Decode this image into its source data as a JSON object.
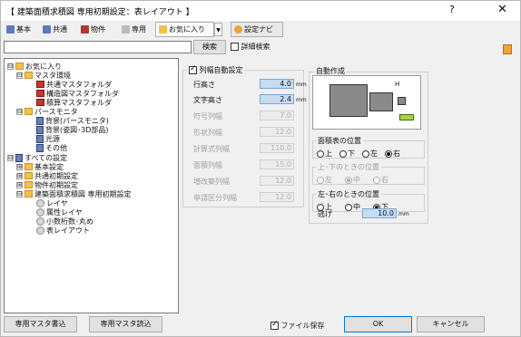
{
  "window": {
    "title": "【 建築面積求積図 専用初期設定：表レイアウト 】",
    "help_label": "?",
    "close_label": "✕"
  },
  "tabs": [
    {
      "label": "基本",
      "icon": "basic-icon",
      "color": "#5a7bbf"
    },
    {
      "label": "共通",
      "icon": "common-icon",
      "color": "#5a7bbf"
    },
    {
      "label": "物件",
      "icon": "property-icon",
      "color": "#b03a2e"
    },
    {
      "label": "専用",
      "icon": "dedicated-icon",
      "color": "#888888"
    },
    {
      "label": "お気に入り",
      "icon": "favorite-icon",
      "color": "#f5c14b"
    },
    {
      "label": "設定ナビ",
      "icon": "navi-icon",
      "color": "#e8a33a"
    }
  ],
  "search": {
    "value": "",
    "button_label": "検索",
    "detail_label": "詳細検索"
  },
  "tree": {
    "nodes": [
      {
        "label": "お気に入り",
        "toggle": "⊟",
        "icon": "fold"
      },
      {
        "label": "マスタ環境",
        "toggle": "⊟",
        "icon": "fold"
      },
      {
        "label": "共通マスタフォルダ",
        "toggle": "",
        "icon": "red"
      },
      {
        "label": "構造図マスタフォルダ",
        "toggle": "",
        "icon": "red"
      },
      {
        "label": "積算マスタフォルダ",
        "toggle": "",
        "icon": "red"
      },
      {
        "label": "パースモニタ",
        "toggle": "⊟",
        "icon": "fold"
      },
      {
        "label": "背景(パースモニタ)",
        "toggle": "",
        "icon": "book"
      },
      {
        "label": "背景(姿図･3D部品)",
        "toggle": "",
        "icon": "book"
      },
      {
        "label": "光源",
        "toggle": "",
        "icon": "book"
      },
      {
        "label": "その他",
        "toggle": "",
        "icon": "book"
      },
      {
        "label": "すべての設定",
        "toggle": "⊟",
        "icon": "book"
      },
      {
        "label": "基本設定",
        "toggle": "⊞",
        "icon": "fold"
      },
      {
        "label": "共通初期設定",
        "toggle": "⊞",
        "icon": "fold"
      },
      {
        "label": "物件初期設定",
        "toggle": "⊞",
        "icon": "fold"
      },
      {
        "label": "建築面積求積図 専用初期設定",
        "toggle": "⊟",
        "icon": "fold"
      },
      {
        "label": "レイヤ",
        "toggle": "",
        "icon": "gear"
      },
      {
        "label": "属性レイヤ",
        "toggle": "",
        "icon": "gear"
      },
      {
        "label": "小数桁数･丸め",
        "toggle": "",
        "icon": "gear"
      },
      {
        "label": "表レイアウト",
        "toggle": "",
        "icon": "gear"
      }
    ]
  },
  "column_settings": {
    "checkbox_label": "列幅自動設定",
    "checked": true,
    "rows": [
      {
        "label": "行高さ",
        "value": "4.0",
        "unit": "mm",
        "disabled": false
      },
      {
        "label": "文字高さ",
        "value": "2.4",
        "unit": "mm",
        "disabled": false
      },
      {
        "label": "符号列幅",
        "value": "7.0",
        "unit": "",
        "disabled": true
      },
      {
        "label": "形状列幅",
        "value": "12.0",
        "unit": "",
        "disabled": true
      },
      {
        "label": "計算式列幅",
        "value": "110.0",
        "unit": "",
        "disabled": true
      },
      {
        "label": "面積列幅",
        "value": "15.0",
        "unit": "",
        "disabled": true
      },
      {
        "label": "増改築列幅",
        "value": "12.0",
        "unit": "",
        "disabled": true
      },
      {
        "label": "申請区分列幅",
        "value": "12.0",
        "unit": "",
        "disabled": true
      }
    ]
  },
  "auto_create": {
    "title": "自動作成",
    "preview_label": "H",
    "area_table_position": {
      "title": "面積表の位置",
      "options": [
        "上",
        "下",
        "左",
        "右"
      ],
      "selected": "右"
    },
    "updown_position": {
      "title": "上･下のときの位置",
      "options": [
        "左",
        "中",
        "右"
      ],
      "selected": "中",
      "disabled": true
    },
    "leftright_position": {
      "title": "左･右のときの位置",
      "options": [
        "上",
        "中",
        "下"
      ],
      "selected": "下"
    },
    "escape": {
      "label": "逃げ",
      "value": "10.0",
      "unit": "mm"
    }
  },
  "footer": {
    "master_write_label": "専用マスタ書込",
    "master_read_label": "専用マスタ読込",
    "save_file_label": "ファイル保存",
    "save_file_checked": true,
    "ok_label": "OK",
    "cancel_label": "キャンセル"
  }
}
